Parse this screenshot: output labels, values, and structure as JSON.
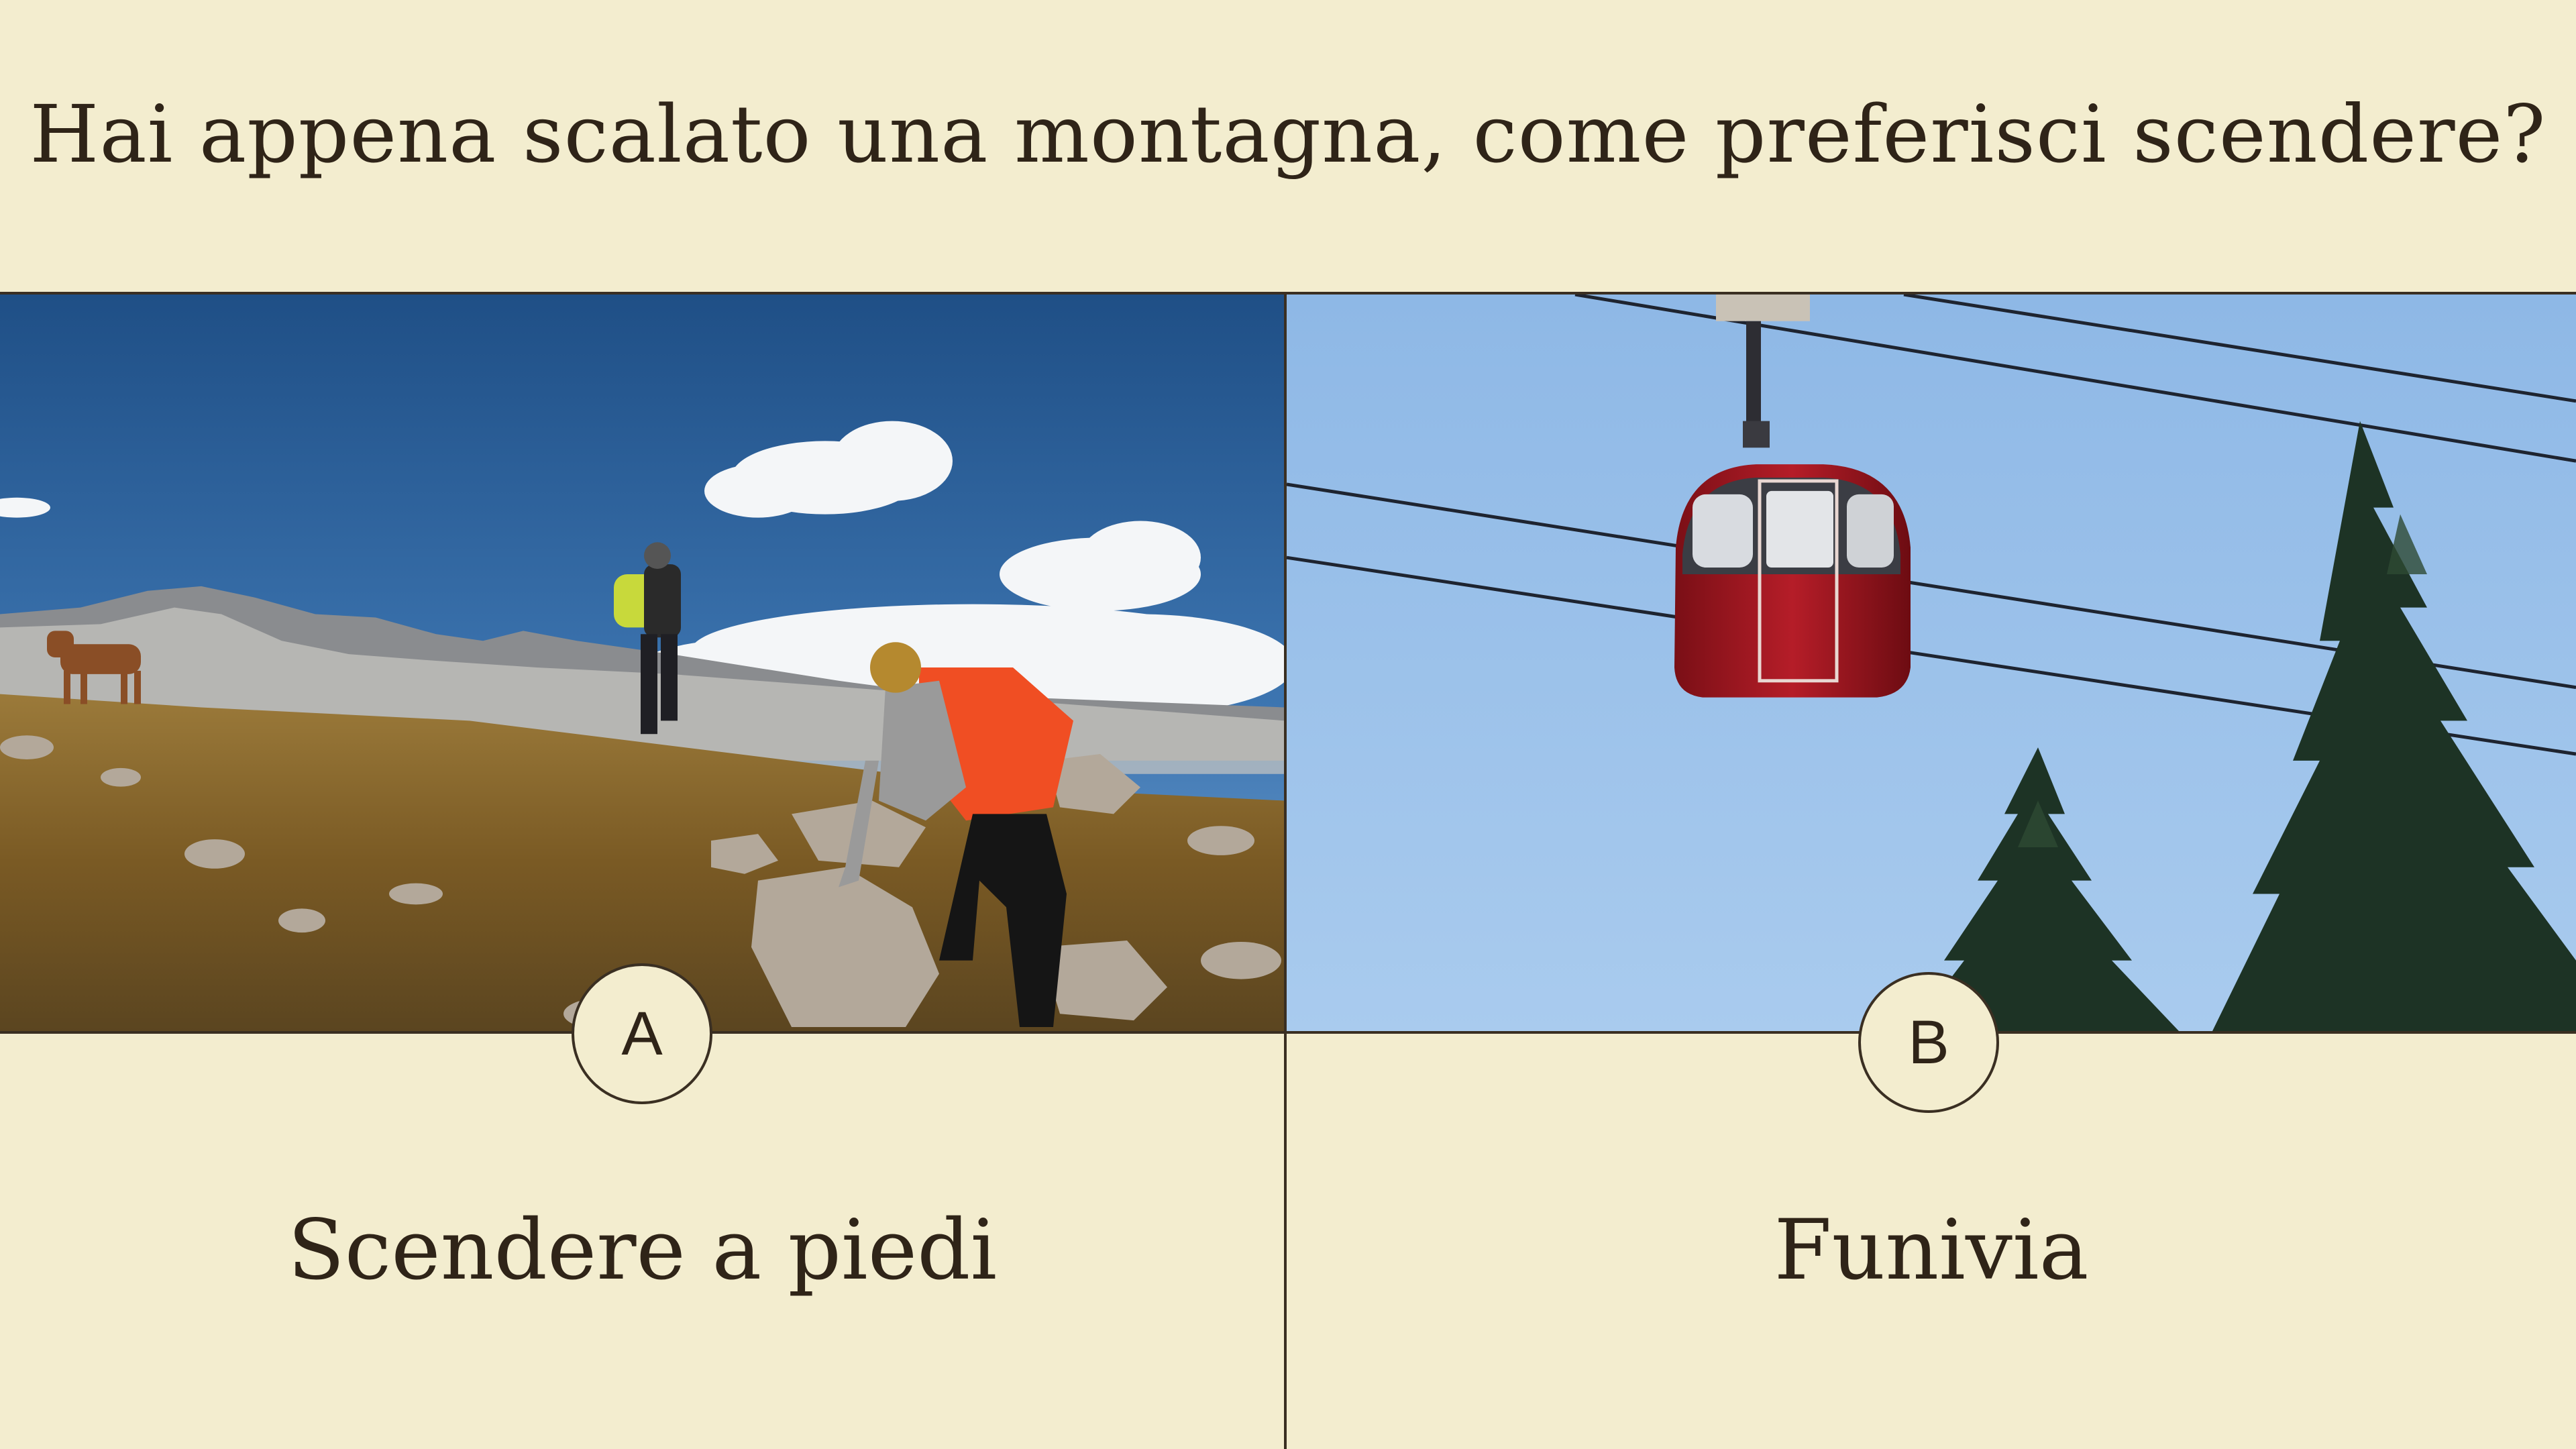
{
  "question": "Hai appena scalato una montagna, come preferisci scendere?",
  "options": [
    {
      "letter": "A",
      "label": "Scendere a piedi",
      "image": "hikers-climbing-rocky-mountain-slope"
    },
    {
      "letter": "B",
      "label": "Funivia",
      "image": "red-cable-car-gondola-over-pine-trees"
    }
  ],
  "colors": {
    "background": "#f3edcf",
    "text": "#2f2418",
    "line": "#3a2f22"
  }
}
